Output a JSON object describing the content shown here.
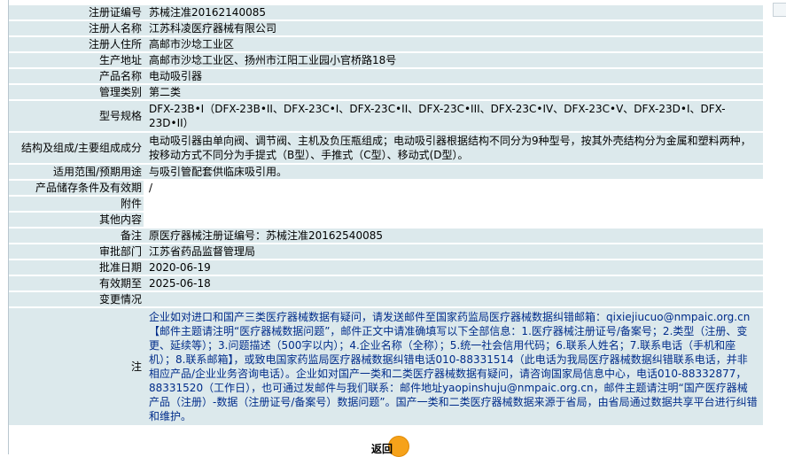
{
  "rows": [
    {
      "label": "注册证编号",
      "value": "苏械注准20162140085"
    },
    {
      "label": "注册人名称",
      "value": "江苏科凌医疗器械有限公司"
    },
    {
      "label": "注册人住所",
      "value": "高邮市沙埝工业区"
    },
    {
      "label": "生产地址",
      "value": "高邮市沙埝工业区、扬州市江阳工业园小官桥路18号"
    },
    {
      "label": "产品名称",
      "value": "电动吸引器"
    },
    {
      "label": "管理类别",
      "value": "第二类"
    },
    {
      "label": "型号规格",
      "value": "DFX-23B•I（DFX-23B•II、DFX-23C•I、DFX-23C•II、DFX-23C•III、DFX-23C•IV、DFX-23C•V、DFX-23D•I、DFX-23D•II）"
    },
    {
      "label": "结构及组成/主要组成成分",
      "value": "电动吸引器由单向阀、调节阀、主机及负压瓶组成；电动吸引器根据结构不同分为9种型号，按其外壳结构分为金属和塑料两种，按移动方式不同分为手提式（B型）、手推式（C型）、移动式(D型）。"
    },
    {
      "label": "适用范围/预期用途",
      "value": "与吸引管配套供临床吸引用。"
    },
    {
      "label": "产品储存条件及有效期",
      "value": "/"
    },
    {
      "label": "附件",
      "value": ""
    },
    {
      "label": "其他内容",
      "value": ""
    },
    {
      "label": "备注",
      "value": "原医疗器械注册证编号：苏械注准20162540085"
    },
    {
      "label": "审批部门",
      "value": "江苏省药品监督管理局"
    },
    {
      "label": "批准日期",
      "value": "2020-06-19"
    },
    {
      "label": "有效期至",
      "value": "2025-06-18"
    },
    {
      "label": "变更情况",
      "value": ""
    }
  ],
  "note": {
    "label": "注",
    "text": "企业如对进口和国产三类医疗器械数据有疑问，请发送邮件至国家药监局医疗器械数据纠错邮箱：qixiejiucuo@nmpaic.org.cn【邮件主题请注明“医疗器械数据问题”，邮件正文中请准确填写以下全部信息：1.医疗器械注册证号/备案号；2.类型（注册、变更、延续等）；3.问题描述（500字以内）；4.企业名称（全称）；5.统一社会信用代码；6.联系人姓名；7.联系电话（手机和座机）；8.联系邮箱】，或致电国家药监局医疗器械数据纠错电话010-88331514（此电话为我局医疗器械数据纠错联系电话，并非相应产品/企业业务咨询电话）。企业如对国产一类和二类医疗器械数据有疑问，请咨询国家局信息中心，电话010-88332877，88331520（工作日），也可通过发邮件与我们联系：邮件地址yaopinshuju@nmpaic.org.cn，邮件主题请注明“国产医疗器械产品（注册）-数据（注册证号/备案号）数据问题”。国产一类和二类医疗器械数据来源于省局，由省局通过数据共享平台进行纠错和维护。"
  },
  "return_button": {
    "label": "返回",
    "color": "#f6a21a"
  }
}
